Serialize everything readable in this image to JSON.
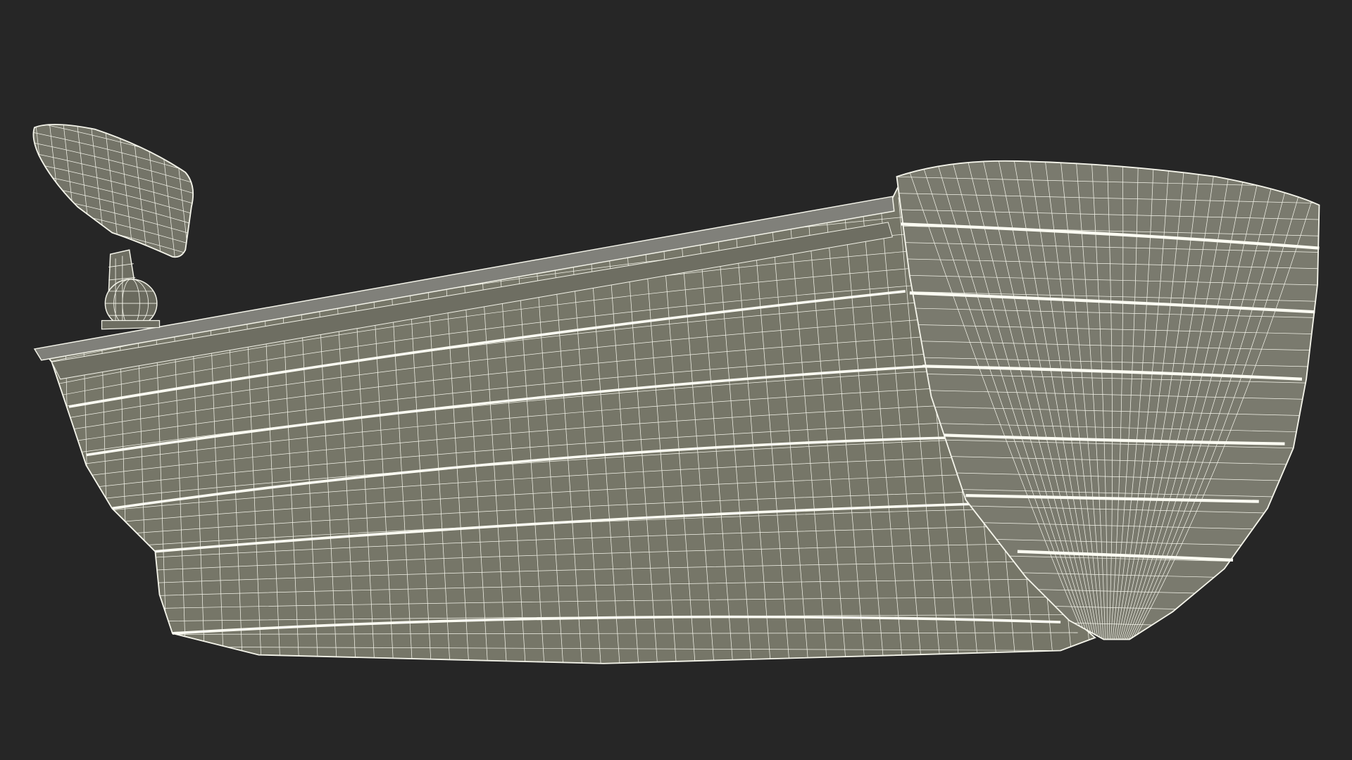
{
  "scene": {
    "background_color": "#262626",
    "hull_fill_color": "#767668",
    "hull_dark_color": "#6a6a5c",
    "hull_light_color": "#82827a",
    "wire_color": "#f4f4ea",
    "objects": [
      {
        "name": "boat-hull",
        "description_icon": "boat-wireframe"
      },
      {
        "name": "outboard-rudder",
        "description_icon": "rudder-wireframe"
      }
    ]
  }
}
